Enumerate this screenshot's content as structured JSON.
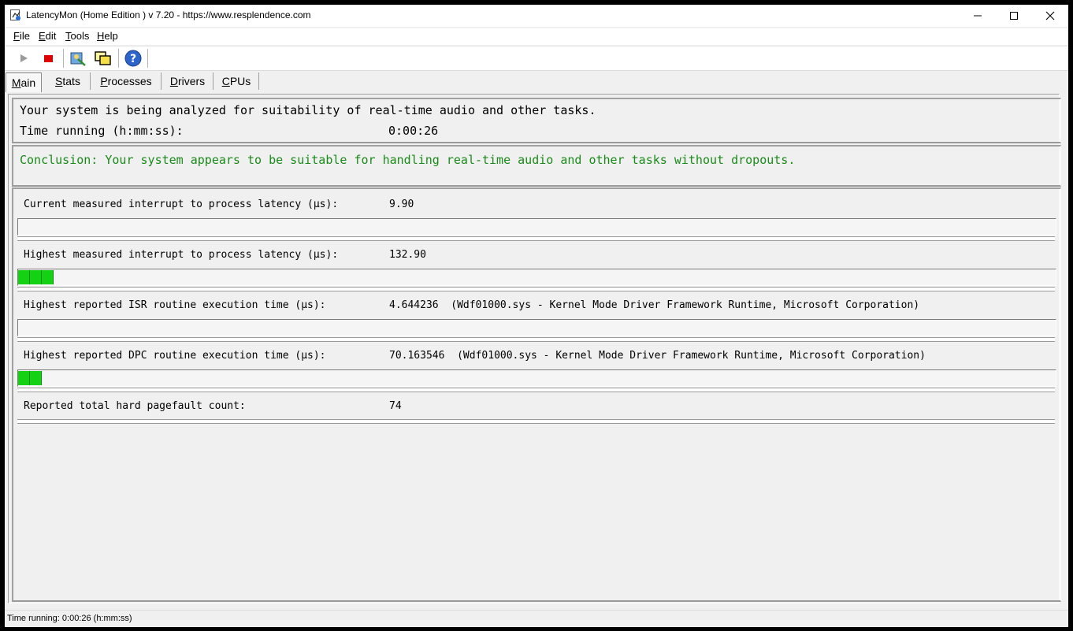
{
  "window": {
    "title": "LatencyMon  (Home Edition )  v 7.20 - https://www.resplendence.com"
  },
  "menu": [
    "File",
    "Edit",
    "Tools",
    "Help"
  ],
  "toolbar": {
    "icons": [
      "play-icon",
      "stop-icon",
      "wizard-icon",
      "windows-icon",
      "help-icon"
    ]
  },
  "tabs": [
    "Main",
    "Stats",
    "Processes",
    "Drivers",
    "CPUs"
  ],
  "status_box": {
    "analyzing_text": "Your system is being analyzed for suitability of real-time audio and other tasks.",
    "time_label": "Time running (h:mm:ss):",
    "time_value": "0:00:26"
  },
  "conclusion": "Conclusion: Your system appears to be suitable for handling real-time audio and other tasks without dropouts.",
  "metrics": [
    {
      "label": "Current measured interrupt to process latency (µs):",
      "value": "9.90",
      "detail": "",
      "bar_segments": 0
    },
    {
      "label": "Highest measured interrupt to process latency (µs):",
      "value": "132.90",
      "detail": "",
      "bar_segments": 3
    },
    {
      "label": "Highest reported ISR routine execution time (µs):",
      "value": "4.644236",
      "detail": "(Wdf01000.sys - Kernel Mode Driver Framework Runtime, Microsoft Corporation)",
      "bar_segments": 0
    },
    {
      "label": "Highest reported DPC routine execution time (µs):",
      "value": "70.163546",
      "detail": "(Wdf01000.sys - Kernel Mode Driver Framework Runtime, Microsoft Corporation)",
      "bar_segments": 2
    },
    {
      "label": "Reported total hard pagefault count:",
      "value": "74",
      "detail": "",
      "bar_segments": 0
    }
  ],
  "statusbar": {
    "text": "Time running: 0:00:26  (h:mm:ss)"
  },
  "colors": {
    "conclusion_green": "#1a8a1a",
    "bar_green": "#14d114"
  }
}
